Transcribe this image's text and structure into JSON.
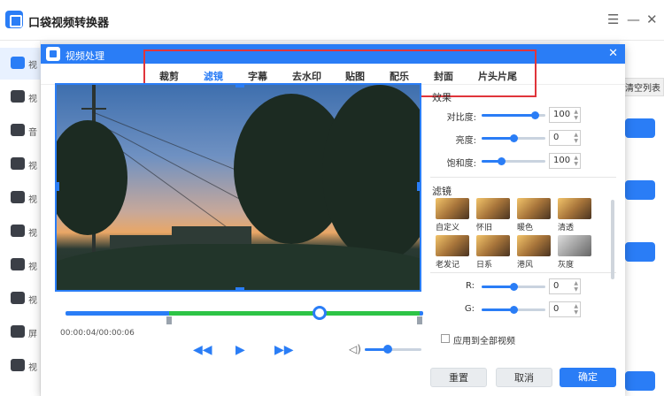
{
  "app": {
    "title": "口袋视频转换器",
    "menu_icon": "menu-icon",
    "minimize_icon": "minimize-icon",
    "close_icon": "close-icon"
  },
  "left_nav": {
    "items": [
      {
        "label": "视",
        "icon": "video-icon",
        "active": true
      },
      {
        "label": "视",
        "icon": "audio-to-video-icon"
      },
      {
        "label": "音",
        "icon": "music-icon"
      },
      {
        "label": "视",
        "icon": "play-icon"
      },
      {
        "label": "视",
        "icon": "film-icon"
      },
      {
        "label": "视",
        "icon": "cloud-icon"
      },
      {
        "label": "视",
        "icon": "image-icon"
      },
      {
        "label": "视",
        "icon": "compress-icon"
      },
      {
        "label": "屏",
        "icon": "screen-record-icon"
      },
      {
        "label": "视",
        "icon": "gif-icon"
      }
    ]
  },
  "background": {
    "clear_list": "清空列表"
  },
  "modal": {
    "title": "视频处理",
    "close_icon": "close-icon",
    "tabs": [
      "裁剪",
      "滤镜",
      "字幕",
      "去水印",
      "贴图",
      "配乐",
      "封面",
      "片头片尾"
    ],
    "active_tab": "滤镜",
    "player": {
      "time": "00:00:04/00:00:06",
      "rewind_icon": "rewind-icon",
      "play_icon": "play-icon",
      "forward_icon": "fast-forward-icon",
      "volume_icon": "volume-icon",
      "playhead_fraction": 0.71,
      "selection_start_fraction": 0.29,
      "selection_end_fraction": 0.99,
      "volume_fraction": 0.4
    },
    "effects": {
      "title": "效果",
      "contrast": {
        "label": "对比度:",
        "value": "100"
      },
      "brightness": {
        "label": "亮度:",
        "value": "0"
      },
      "saturation": {
        "label": "饱和度:",
        "value": "100"
      }
    },
    "filters": {
      "title": "滤镜",
      "items": [
        "自定义",
        "怀旧",
        "暖色",
        "清透",
        "老发记",
        "日系",
        "港风",
        "灰度"
      ]
    },
    "rgb": {
      "r": {
        "label": "R:",
        "value": "0"
      },
      "g": {
        "label": "G:",
        "value": "0"
      }
    },
    "apply_all": "应用到全部视频",
    "buttons": {
      "reset": "重置",
      "cancel": "取消",
      "confirm": "确定"
    }
  },
  "colors": {
    "accent": "#2a7df6",
    "selection": "#2dc446",
    "highlight_box": "#e0353b"
  }
}
